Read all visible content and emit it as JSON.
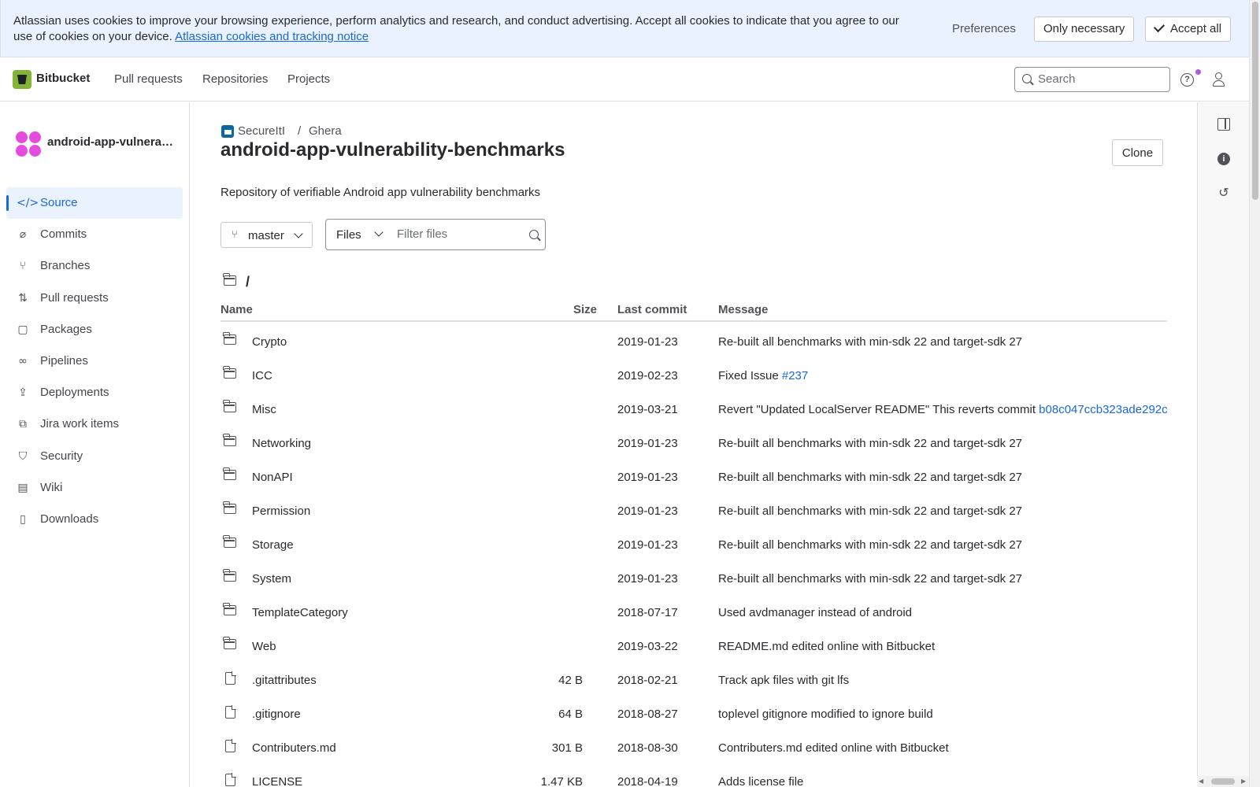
{
  "cookie_banner": {
    "text": "Atlassian uses cookies to improve your browsing experience, perform analytics and research, and conduct advertising. Accept all cookies to indicate that you agree to our use of cookies on your device. ",
    "link": "Atlassian cookies and tracking notice",
    "preferences": "Preferences",
    "only_necessary": "Only necessary",
    "accept_all": "Accept all"
  },
  "topnav": {
    "brand": "Bitbucket",
    "links": [
      "Pull requests",
      "Repositories",
      "Projects"
    ],
    "search_placeholder": "Search",
    "help_icon": "?",
    "notification_dot_color": "#af59e1"
  },
  "sidebar": {
    "repo_name": "android-app-vulnerability-benchmarks",
    "repo_avatar_color": "#e54cde",
    "items": [
      {
        "label": "Source",
        "icon": "code-icon",
        "glyph": "</>",
        "active": true
      },
      {
        "label": "Commits",
        "icon": "commit-icon",
        "glyph": "⌀"
      },
      {
        "label": "Branches",
        "icon": "branch-icon",
        "glyph": "⑂"
      },
      {
        "label": "Pull requests",
        "icon": "pull-request-icon",
        "glyph": "⇅"
      },
      {
        "label": "Packages",
        "icon": "package-icon",
        "glyph": "▢"
      },
      {
        "label": "Pipelines",
        "icon": "pipeline-icon",
        "glyph": "∞"
      },
      {
        "label": "Deployments",
        "icon": "deployment-icon",
        "glyph": "⇪"
      },
      {
        "label": "Jira work items",
        "icon": "jira-icon",
        "glyph": "⧉"
      },
      {
        "label": "Security",
        "icon": "shield-icon",
        "glyph": "⛉"
      },
      {
        "label": "Wiki",
        "icon": "wiki-icon",
        "glyph": "▤"
      },
      {
        "label": "Downloads",
        "icon": "download-icon",
        "glyph": "▯"
      }
    ]
  },
  "main": {
    "breadcrumb": {
      "workspace": "SecureItI",
      "separator": "/",
      "project": "Ghera"
    },
    "title": "android-app-vulnerability-benchmarks",
    "clone_label": "Clone",
    "description": "Repository of verifiable Android app vulnerability benchmarks",
    "branch": "master",
    "filter_type": "Files",
    "filter_placeholder": "Filter files",
    "path": "/",
    "columns": {
      "name": "Name",
      "size": "Size",
      "last_commit": "Last commit",
      "message": "Message"
    },
    "rows": [
      {
        "type": "folder",
        "name": "Crypto",
        "size": "",
        "date": "2019-01-23",
        "message": "Re-built all benchmarks with min-sdk 22 and target-sdk 27",
        "link": ""
      },
      {
        "type": "folder",
        "name": "ICC",
        "size": "",
        "date": "2019-02-23",
        "message": "Fixed Issue ",
        "link": "#237"
      },
      {
        "type": "folder",
        "name": "Misc",
        "size": "",
        "date": "2019-03-21",
        "message": "Revert \"Updated LocalServer README\" This reverts commit ",
        "link": "b08c047ccb323ade292c"
      },
      {
        "type": "folder",
        "name": "Networking",
        "size": "",
        "date": "2019-01-23",
        "message": "Re-built all benchmarks with min-sdk 22 and target-sdk 27",
        "link": ""
      },
      {
        "type": "folder",
        "name": "NonAPI",
        "size": "",
        "date": "2019-01-23",
        "message": "Re-built all benchmarks with min-sdk 22 and target-sdk 27",
        "link": ""
      },
      {
        "type": "folder",
        "name": "Permission",
        "size": "",
        "date": "2019-01-23",
        "message": "Re-built all benchmarks with min-sdk 22 and target-sdk 27",
        "link": ""
      },
      {
        "type": "folder",
        "name": "Storage",
        "size": "",
        "date": "2019-01-23",
        "message": "Re-built all benchmarks with min-sdk 22 and target-sdk 27",
        "link": ""
      },
      {
        "type": "folder",
        "name": "System",
        "size": "",
        "date": "2019-01-23",
        "message": "Re-built all benchmarks with min-sdk 22 and target-sdk 27",
        "link": ""
      },
      {
        "type": "folder",
        "name": "TemplateCategory",
        "size": "",
        "date": "2018-07-17",
        "message": "Used avdmanager instead of android",
        "link": ""
      },
      {
        "type": "folder",
        "name": "Web",
        "size": "",
        "date": "2019-03-22",
        "message": "README.md edited online with Bitbucket",
        "link": ""
      },
      {
        "type": "file",
        "name": ".gitattributes",
        "size": "42 B",
        "date": "2018-02-21",
        "message": "Track apk files with git lfs",
        "link": ""
      },
      {
        "type": "file",
        "name": ".gitignore",
        "size": "64 B",
        "date": "2018-08-27",
        "message": "toplevel gitignore modified to ignore build",
        "link": ""
      },
      {
        "type": "file",
        "name": "Contributers.md",
        "size": "301 B",
        "date": "2018-08-30",
        "message": "Contributers.md edited online with Bitbucket",
        "link": ""
      },
      {
        "type": "file",
        "name": "LICENSE",
        "size": "1.47 KB",
        "date": "2018-04-19",
        "message": "Adds license file",
        "link": ""
      }
    ]
  },
  "right_rail": {
    "icons": [
      "side-panel-icon",
      "info-icon",
      "history-icon"
    ],
    "info_glyph": "i",
    "history_glyph": "↺"
  },
  "colors": {
    "accent": "#1868db",
    "banner_bg": "#e9f2fe",
    "logo": "#82b536"
  }
}
